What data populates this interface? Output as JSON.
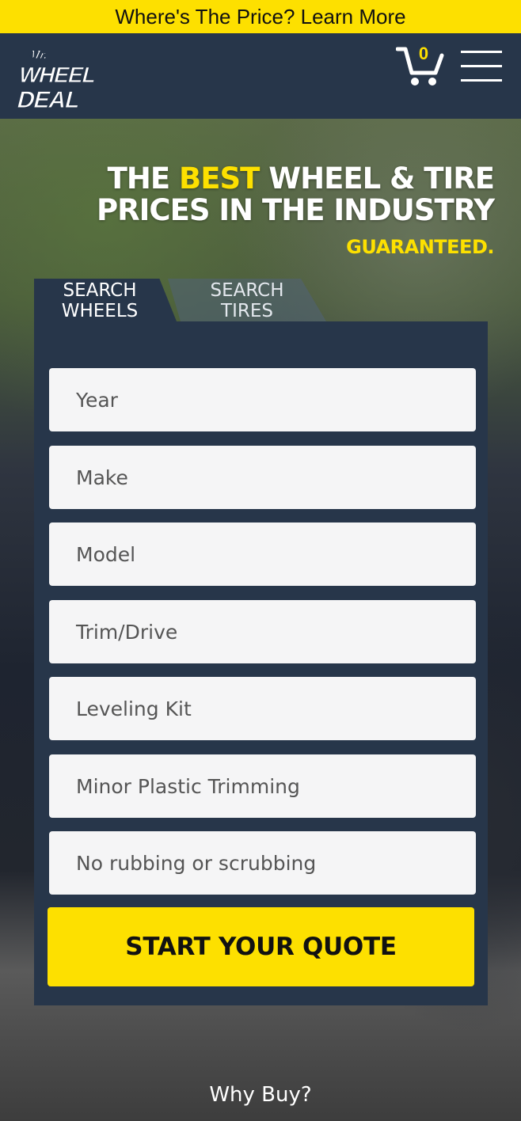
{
  "promo": {
    "text": "Where's The Price? Learn More"
  },
  "header": {
    "logo_alt": "Mr. Wheel Deal",
    "cart_count": "0",
    "icons": [
      "cart-icon",
      "menu-icon"
    ]
  },
  "hero": {
    "line1_accent": "BEST",
    "line1_pre": "THE ",
    "line1_post": " WHEEL & TIRE",
    "line2": "PRICES IN THE INDUSTRY",
    "tagline": "GUARANTEED."
  },
  "tabs": [
    {
      "label_top": "SEARCH",
      "label_bottom": "WHEELS",
      "active": true
    },
    {
      "label_top": "SEARCH",
      "label_bottom": "TIRES",
      "active": false
    }
  ],
  "form": {
    "fields": [
      {
        "placeholder": "Year"
      },
      {
        "placeholder": "Make"
      },
      {
        "placeholder": "Model"
      },
      {
        "placeholder": "Trim/Drive"
      },
      {
        "placeholder": "Leveling Kit"
      },
      {
        "placeholder": "Minor Plastic Trimming"
      },
      {
        "placeholder": "No rubbing or scrubbing"
      }
    ],
    "submit_label": "START YOUR QUOTE"
  },
  "footer": {
    "why_buy": "Why Buy?"
  },
  "colors": {
    "accent": "#fde000",
    "navy": "#27364a"
  }
}
